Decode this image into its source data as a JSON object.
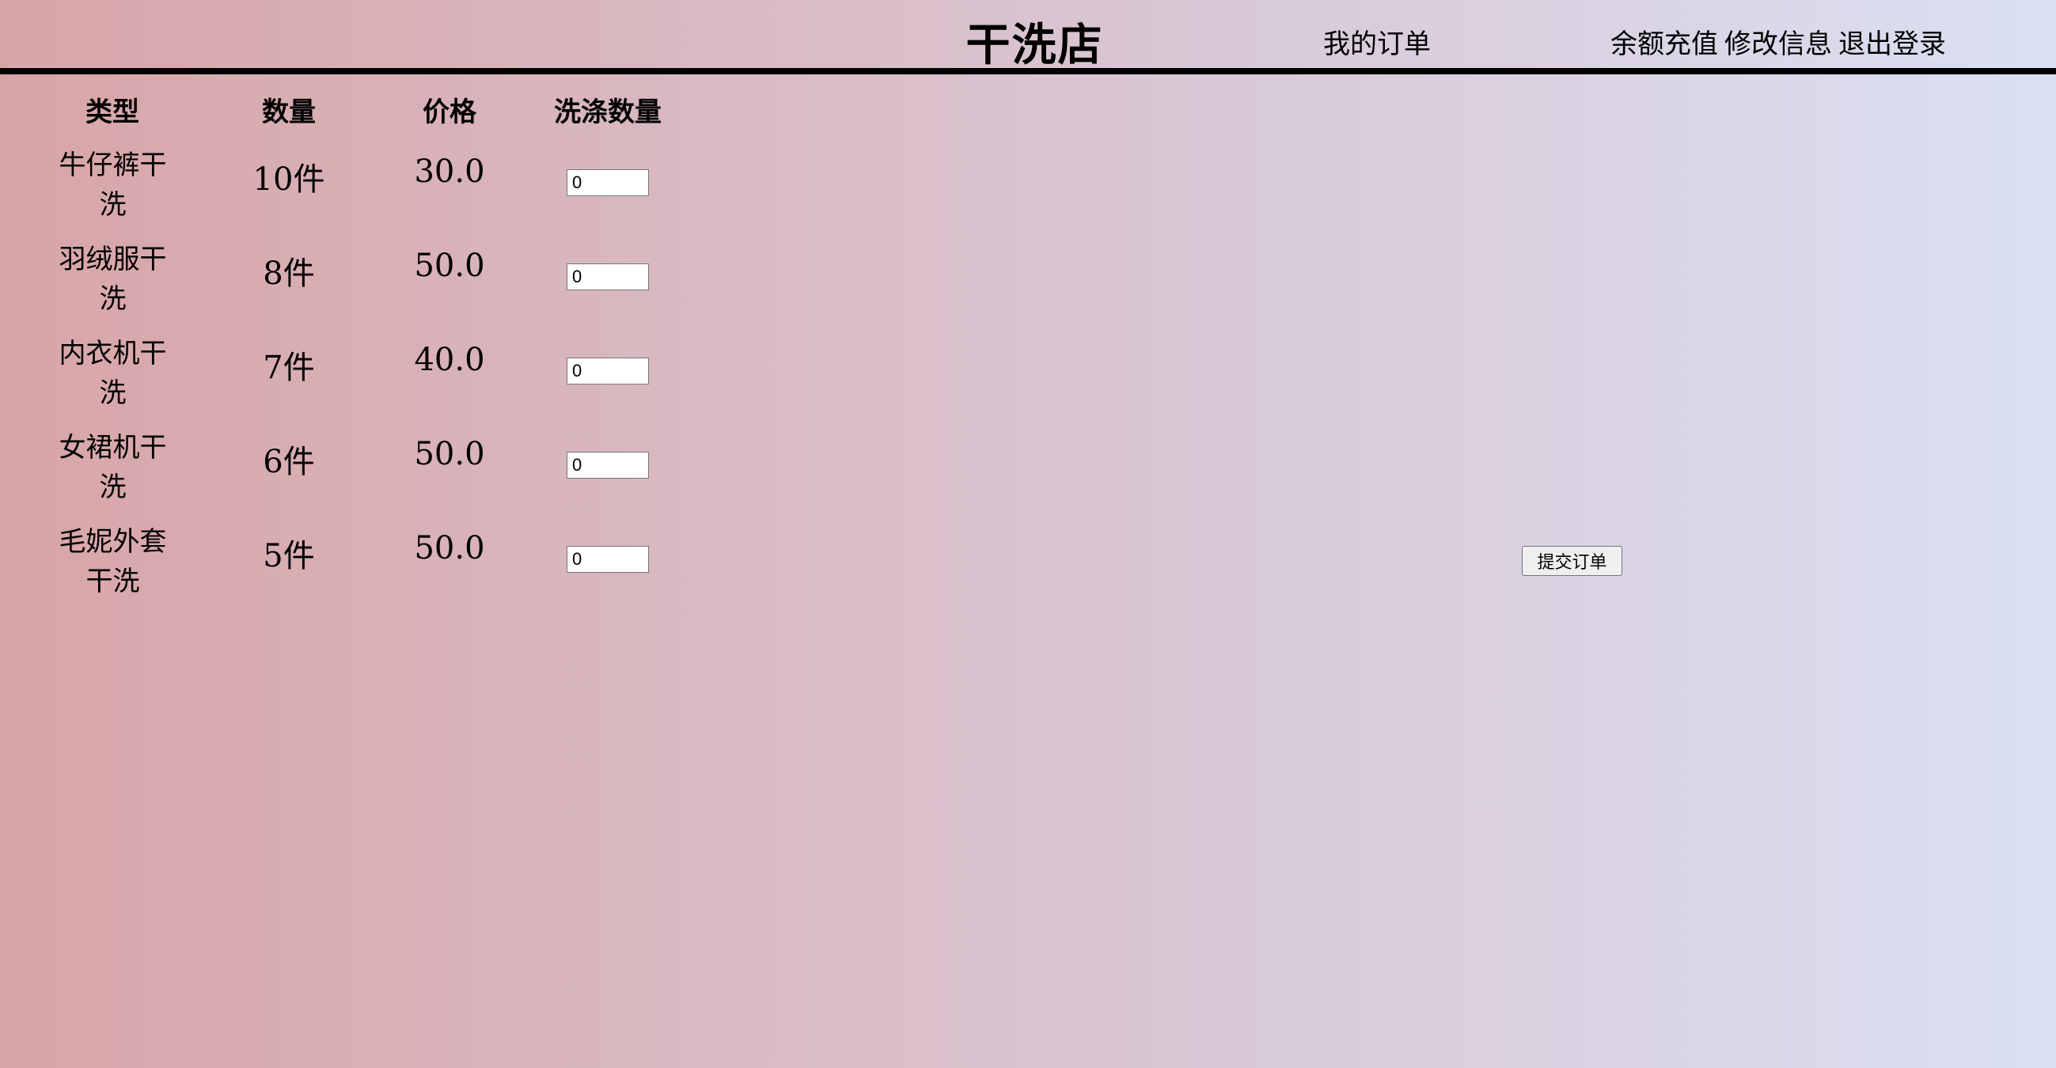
{
  "header": {
    "title": "干洗店",
    "nav_orders": "我的订单",
    "nav_recharge": "余额充值",
    "nav_edit": "修改信息",
    "nav_logout": "退出登录"
  },
  "table": {
    "columns": [
      "类型",
      "数量",
      "价格",
      "洗涤数量"
    ],
    "rows": [
      {
        "type_line1": "牛仔裤干",
        "type_line2": "洗",
        "quantity": "10件",
        "price": "30.0",
        "wash_count": "0"
      },
      {
        "type_line1": "羽绒服干",
        "type_line2": "洗",
        "quantity": "8件",
        "price": "50.0",
        "wash_count": "0"
      },
      {
        "type_line1": "内衣机干",
        "type_line2": "洗",
        "quantity": "7件",
        "price": "40.0",
        "wash_count": "0"
      },
      {
        "type_line1": "女裙机干",
        "type_line2": "洗",
        "quantity": "6件",
        "price": "50.0",
        "wash_count": "0"
      },
      {
        "type_line1": "毛妮外套",
        "type_line2": "干洗",
        "quantity": "5件",
        "price": "50.0",
        "wash_count": "0"
      }
    ]
  },
  "submit_label": "提交订单"
}
